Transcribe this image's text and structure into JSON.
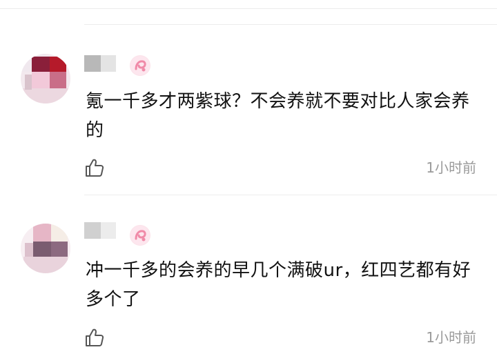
{
  "comments": [
    {
      "text": "氪一千多才两紫球？不会养就不要对比人家会养的",
      "time": "1小时前"
    },
    {
      "text": "冲一千多的会养的早几个满破ur，红四艺都有好多个了",
      "time": "1小时前"
    }
  ],
  "icons": {
    "like": "thumbs-up-icon",
    "badge": "pink-badge-icon"
  },
  "colors": {
    "text": "#111111",
    "meta": "#9a9a9a",
    "divider": "#ececec",
    "badge": "#f2a0b8"
  }
}
